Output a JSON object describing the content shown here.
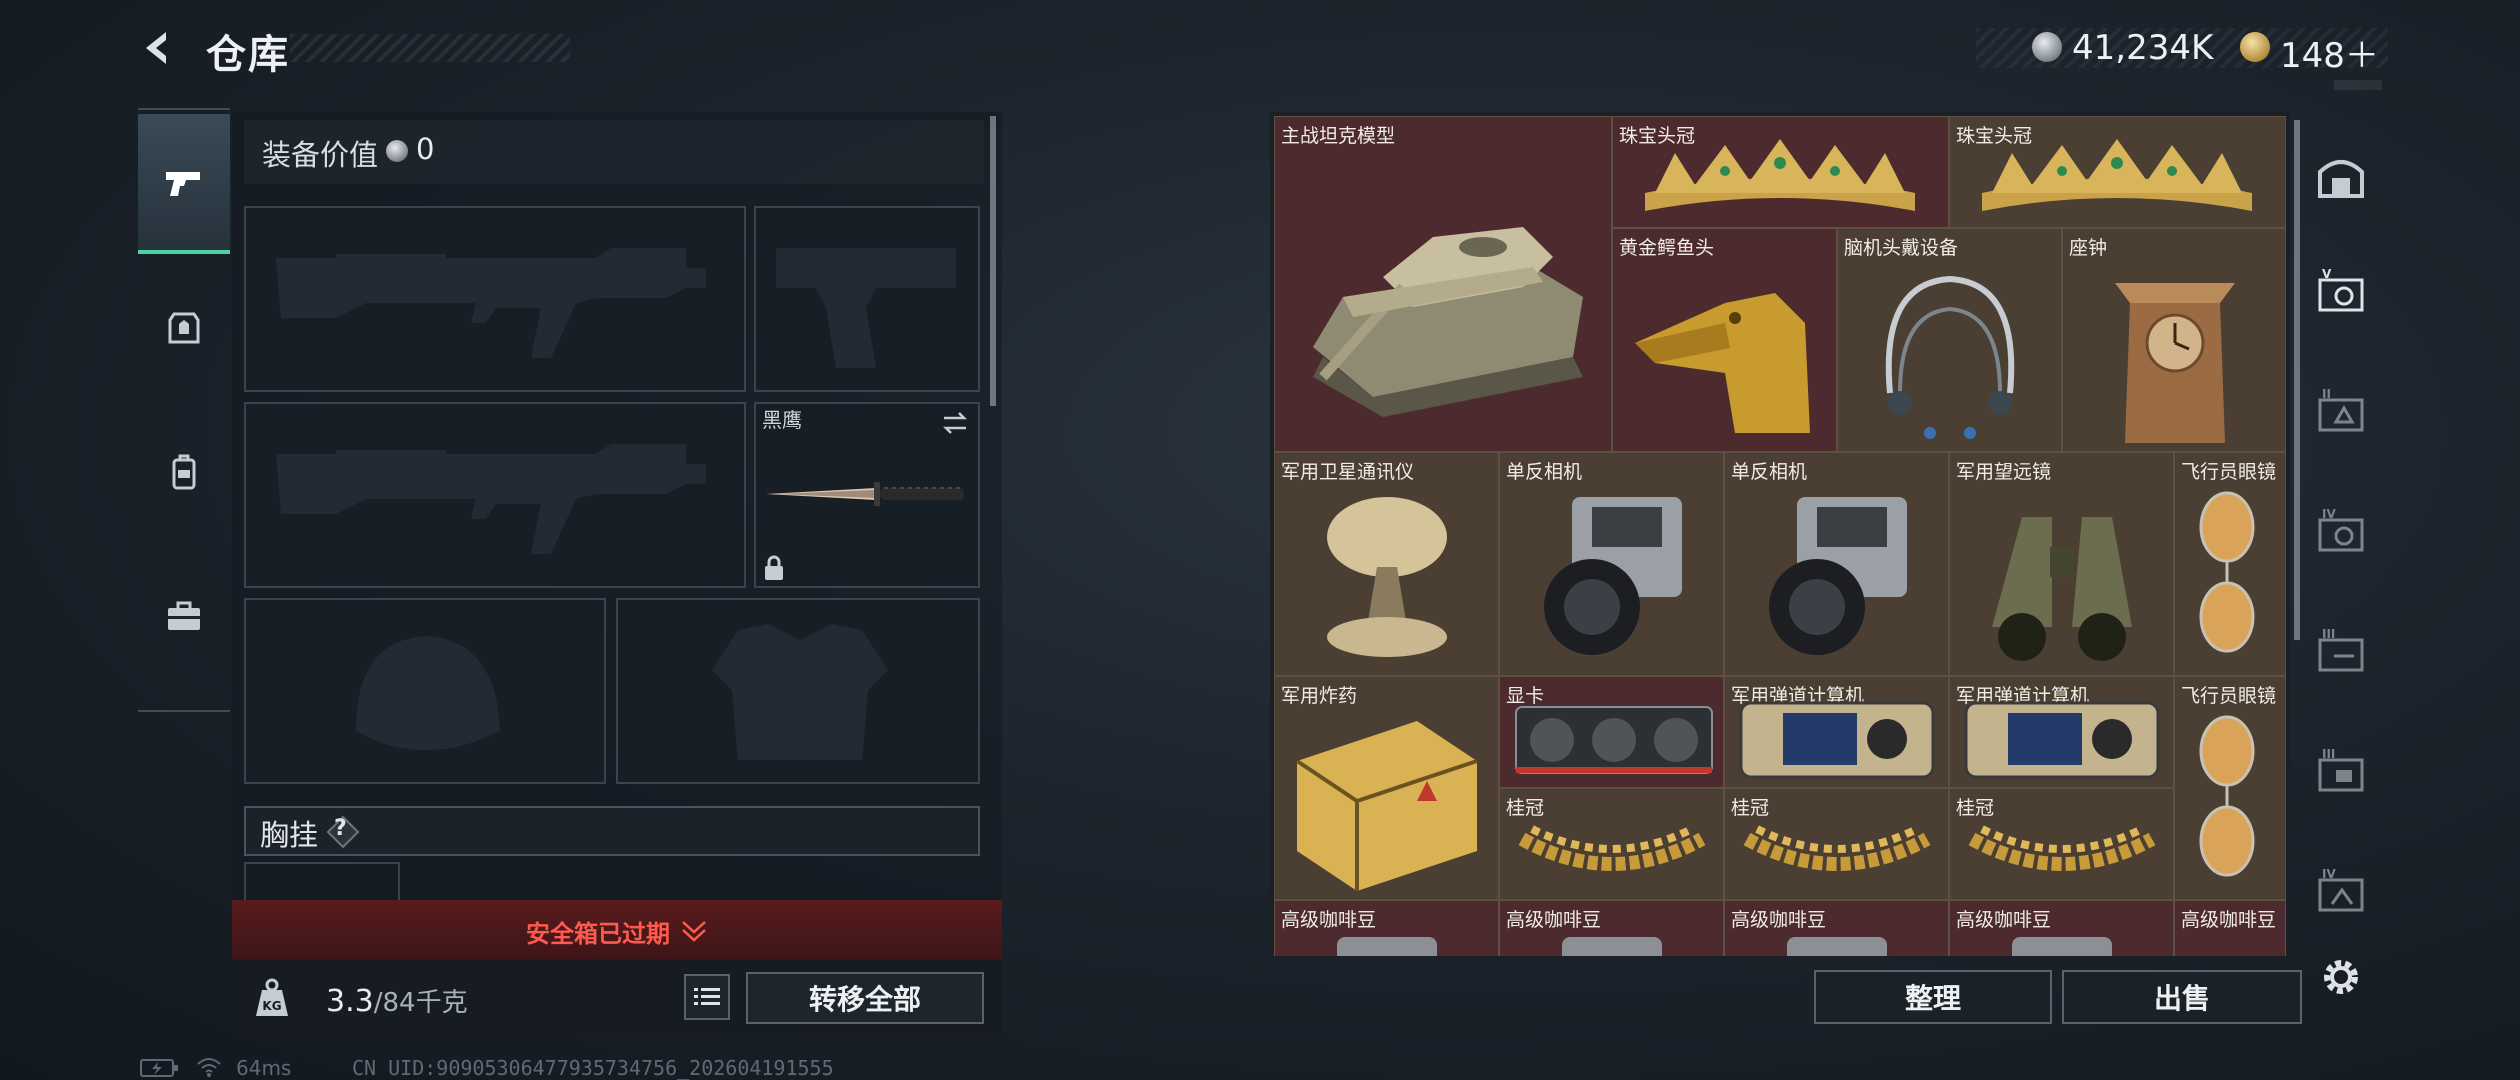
{
  "header": {
    "title": "仓库",
    "silver_amount": "41,234K",
    "gold_amount": "148＋"
  },
  "left_tabs": [
    {
      "name": "weapons",
      "icon": "pistol-icon",
      "active": true
    },
    {
      "name": "armor",
      "icon": "armor-icon",
      "active": false
    },
    {
      "name": "backpack",
      "icon": "backpack-icon",
      "active": false
    },
    {
      "name": "case",
      "icon": "briefcase-icon",
      "active": false
    }
  ],
  "equipment": {
    "value_label": "装备价值",
    "value": "0",
    "knife_name": "黑鹰",
    "vest_label": "胸挂",
    "vest_help": "?"
  },
  "safebox": {
    "text": "安全箱已过期"
  },
  "carry": {
    "weight": "3.3",
    "capacity": "/84千克",
    "transfer_label": "转移全部"
  },
  "status": {
    "ping": "64ms",
    "uid": "CN UID:9090530647793573475​6_202604191555"
  },
  "storage_items": [
    {
      "name": "主战坦克模型",
      "icon": "tank-icon"
    },
    {
      "name": "珠宝头冠",
      "icon": "crown-icon"
    },
    {
      "name": "珠宝头冠",
      "icon": "crown-icon"
    },
    {
      "name": "黄金鳄鱼头",
      "icon": "gold-crocodile-head-icon"
    },
    {
      "name": "脑机头戴设备",
      "icon": "headset-icon"
    },
    {
      "name": "座钟",
      "icon": "clock-icon"
    },
    {
      "name": "军用卫星通讯仪",
      "icon": "satellite-dish-icon"
    },
    {
      "name": "单反相机",
      "icon": "camera-icon"
    },
    {
      "name": "单反相机",
      "icon": "camera-icon"
    },
    {
      "name": "军用望远镜",
      "icon": "binoculars-icon"
    },
    {
      "name": "飞行员眼镜",
      "icon": "sunglasses-icon"
    },
    {
      "name": "军用炸药",
      "icon": "explosive-crate-icon"
    },
    {
      "name": "显卡",
      "icon": "gpu-icon"
    },
    {
      "name": "军用弹道计算机",
      "icon": "ballistic-computer-icon"
    },
    {
      "name": "军用弹道计算机",
      "icon": "ballistic-computer-icon"
    },
    {
      "name": "飞行员眼镜",
      "icon": "sunglasses-icon"
    },
    {
      "name": "桂冠",
      "icon": "laurel-icon"
    },
    {
      "name": "桂冠",
      "icon": "laurel-icon"
    },
    {
      "name": "桂冠",
      "icon": "laurel-icon"
    },
    {
      "name": "高级咖啡豆",
      "icon": "coffee-bean-icon"
    },
    {
      "name": "高级咖啡豆",
      "icon": "coffee-bean-icon"
    },
    {
      "name": "高级咖啡豆",
      "icon": "coffee-bean-icon"
    },
    {
      "name": "高级咖啡豆",
      "icon": "coffee-bean-icon"
    },
    {
      "name": "高级咖啡豆",
      "icon": "coffee-bean-icon"
    }
  ],
  "storage_actions": {
    "sort_label": "整理",
    "sell_label": "出售"
  },
  "right_tabs": [
    {
      "name": "storage-main",
      "icon": "bunker-icon"
    },
    {
      "name": "storage-V",
      "icon": "storage-v-icon"
    },
    {
      "name": "storage-II",
      "icon": "storage-ii-icon"
    },
    {
      "name": "storage-IV",
      "icon": "storage-iv-icon"
    },
    {
      "name": "storage-III",
      "icon": "storage-iii-icon"
    },
    {
      "name": "storage-III-b",
      "icon": "storage-iii-b-icon"
    },
    {
      "name": "storage-IV-b",
      "icon": "storage-iv-b-icon"
    }
  ],
  "colors": {
    "accent_green": "#4fd1a5",
    "warning_red": "#ff5a4e",
    "cell_red": "#4d2a2e",
    "cell_gold": "#4b3f33"
  }
}
